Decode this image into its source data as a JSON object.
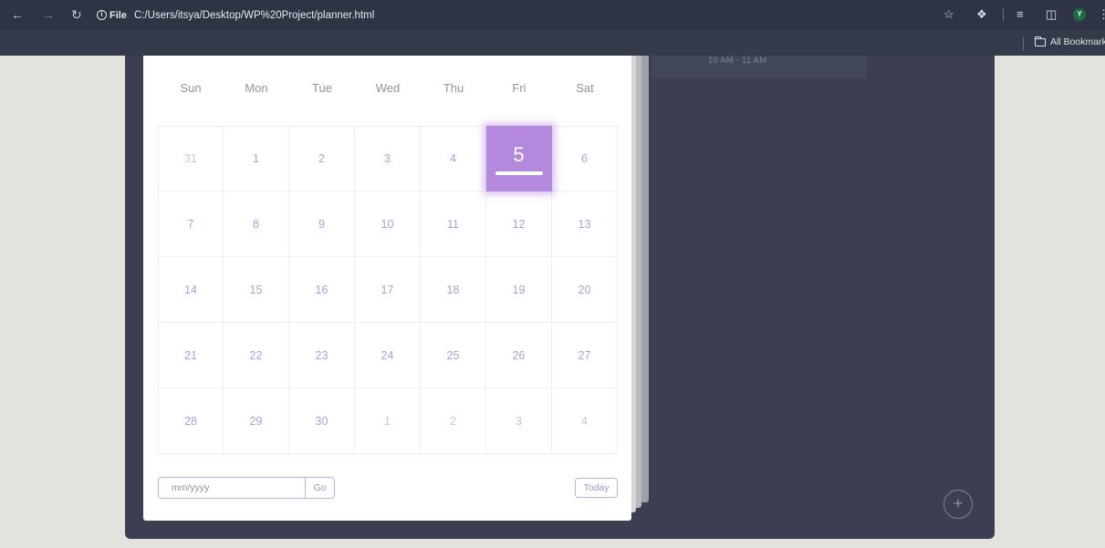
{
  "browser": {
    "file_label": "File",
    "url": "C:/Users/itsya/Desktop/WP%20Project/planner.html",
    "avatar_initial": "Y",
    "bookmarks_label": "All Bookmarks"
  },
  "schedule": {
    "time_label": "10 AM - 11 AM"
  },
  "calendar": {
    "weekdays": [
      "Sun",
      "Mon",
      "Tue",
      "Wed",
      "Thu",
      "Fri",
      "Sat"
    ],
    "selected_day": "5",
    "weeks": [
      [
        {
          "d": "31",
          "o": true
        },
        {
          "d": "1"
        },
        {
          "d": "2"
        },
        {
          "d": "3"
        },
        {
          "d": "4"
        },
        {
          "d": "5",
          "t": true
        },
        {
          "d": "6"
        }
      ],
      [
        {
          "d": "7"
        },
        {
          "d": "8"
        },
        {
          "d": "9"
        },
        {
          "d": "10"
        },
        {
          "d": "11"
        },
        {
          "d": "12"
        },
        {
          "d": "13"
        }
      ],
      [
        {
          "d": "14"
        },
        {
          "d": "15"
        },
        {
          "d": "16"
        },
        {
          "d": "17"
        },
        {
          "d": "18"
        },
        {
          "d": "19"
        },
        {
          "d": "20"
        }
      ],
      [
        {
          "d": "21"
        },
        {
          "d": "22"
        },
        {
          "d": "23"
        },
        {
          "d": "24"
        },
        {
          "d": "25"
        },
        {
          "d": "26"
        },
        {
          "d": "27"
        }
      ],
      [
        {
          "d": "28"
        },
        {
          "d": "29"
        },
        {
          "d": "30"
        },
        {
          "d": "1",
          "o": true
        },
        {
          "d": "2",
          "o": true
        },
        {
          "d": "3",
          "o": true
        },
        {
          "d": "4",
          "o": true
        }
      ]
    ]
  },
  "controls": {
    "month_placeholder": "mm/yyyy",
    "go_label": "Go",
    "today_label": "Today",
    "add_label": "+"
  },
  "colors": {
    "accent": "#b388dd",
    "panel": "#3b3f51",
    "chrome": "#2e3443"
  }
}
